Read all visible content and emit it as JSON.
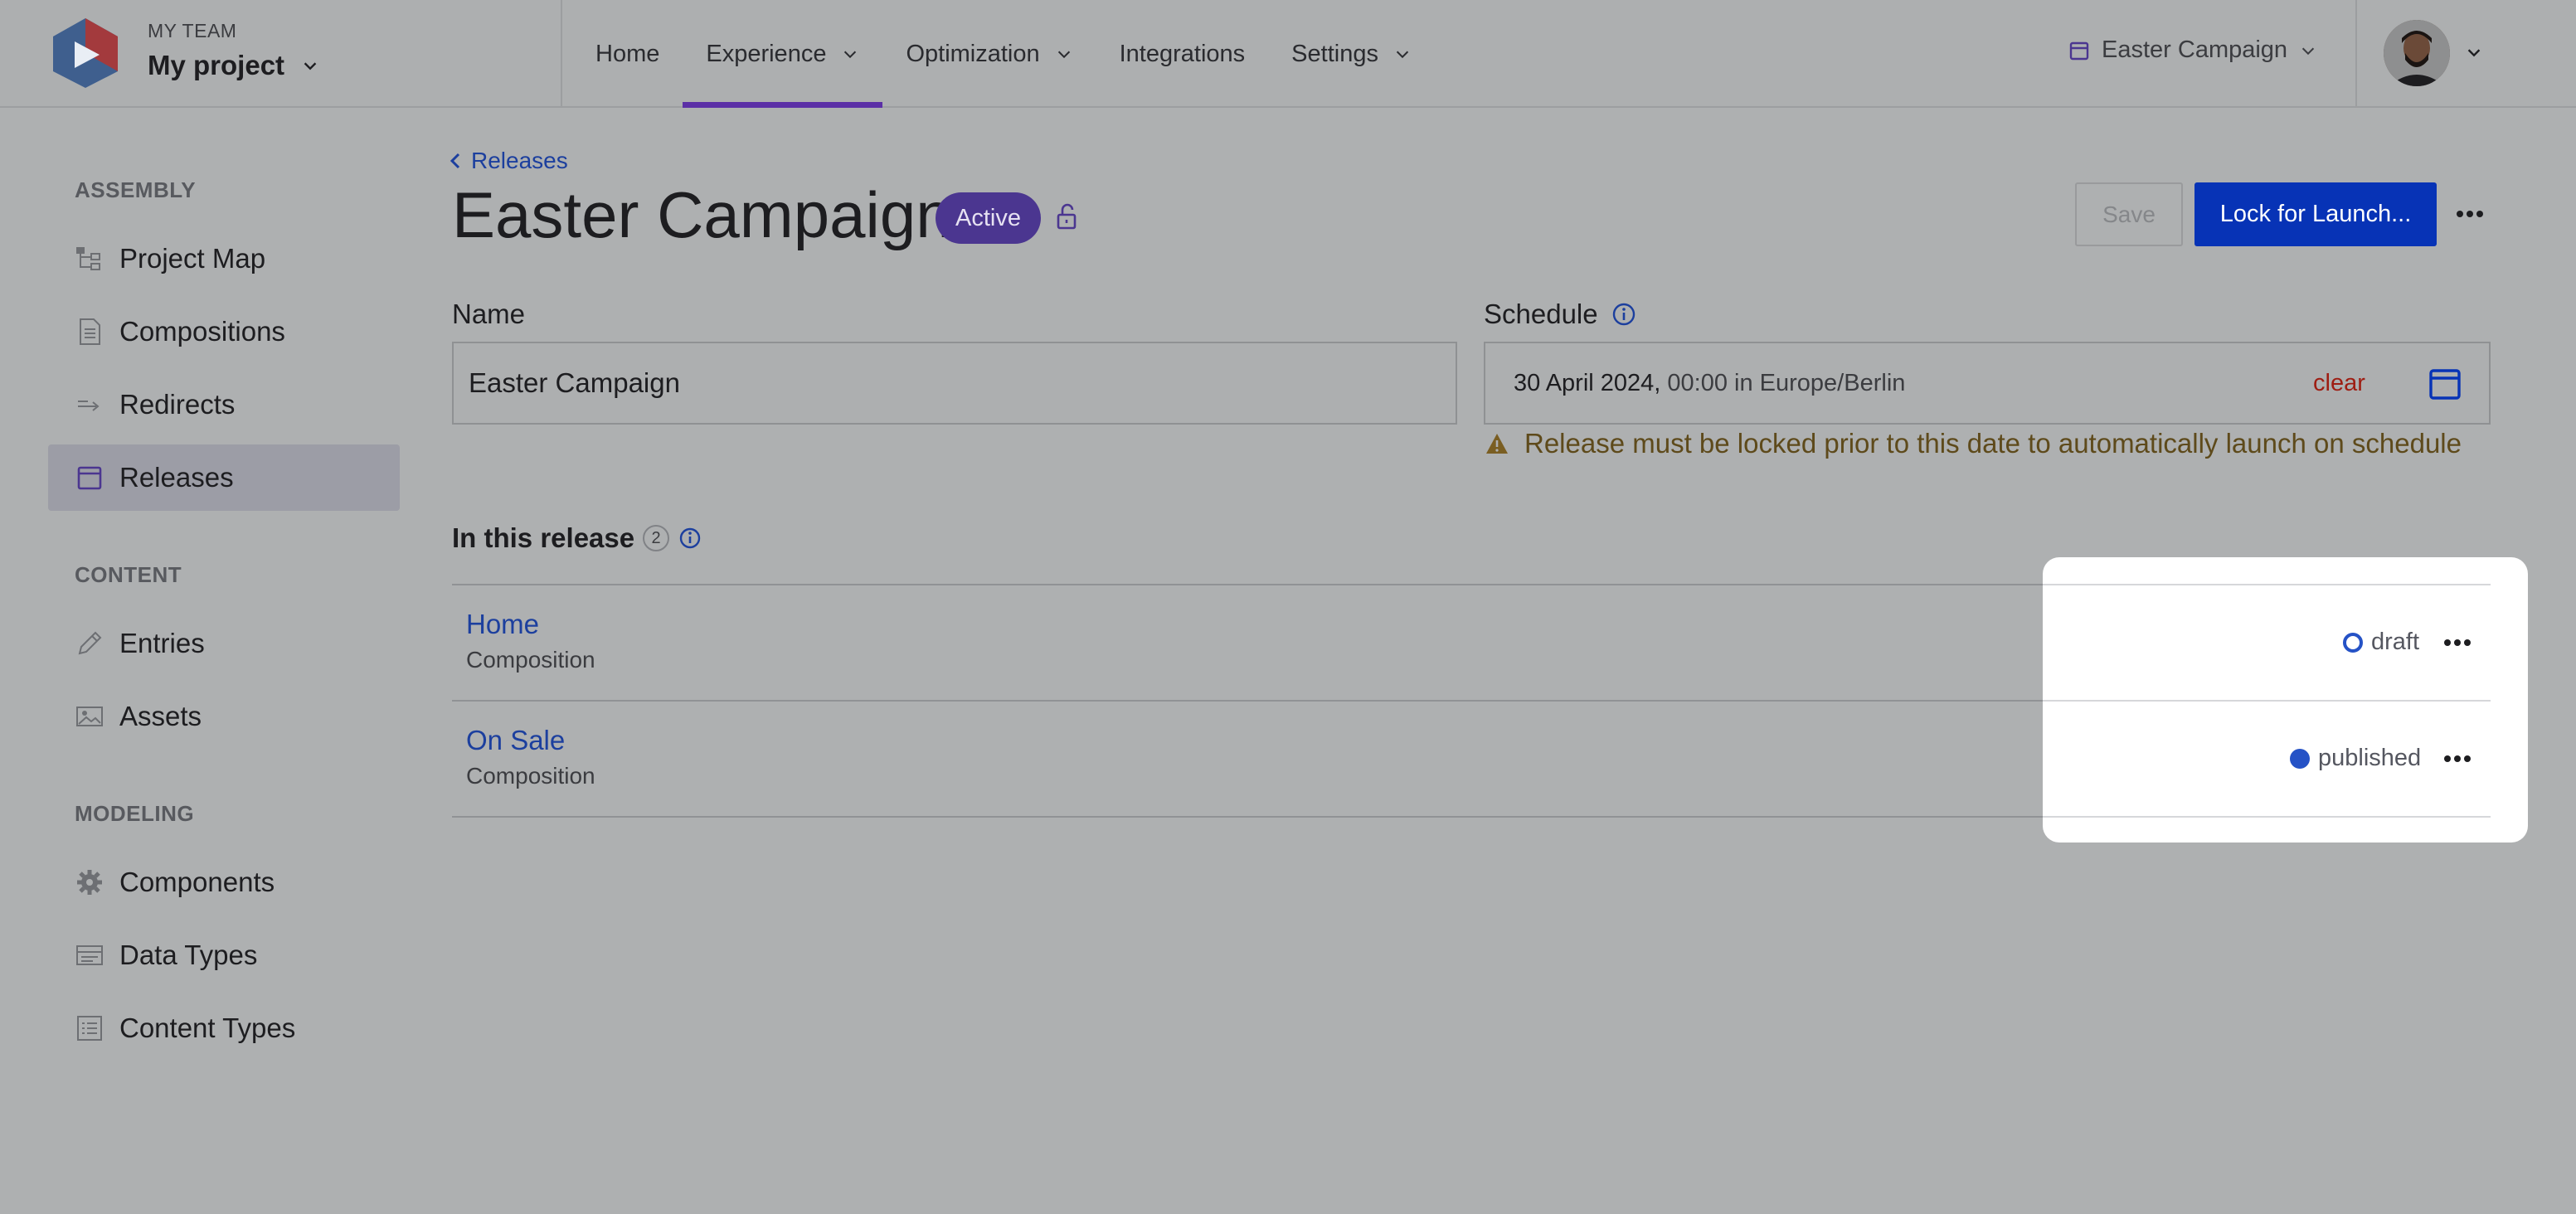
{
  "header": {
    "team_label": "MY TEAM",
    "project_name": "My project",
    "nav": [
      {
        "label": "Home"
      },
      {
        "label": "Experience"
      },
      {
        "label": "Optimization"
      },
      {
        "label": "Integrations"
      },
      {
        "label": "Settings"
      }
    ],
    "release_picker": "Easter Campaign"
  },
  "sidebar": {
    "sections": [
      {
        "heading": "ASSEMBLY",
        "items": [
          "Project Map",
          "Compositions",
          "Redirects",
          "Releases"
        ]
      },
      {
        "heading": "CONTENT",
        "items": [
          "Entries",
          "Assets"
        ]
      },
      {
        "heading": "MODELING",
        "items": [
          "Components",
          "Data Types",
          "Content Types"
        ]
      }
    ],
    "selected": "Releases"
  },
  "main": {
    "breadcrumb": "Releases",
    "title": "Easter Campaign",
    "status_badge": "Active",
    "save_label": "Save",
    "lock_label": "Lock for Launch...",
    "name_label": "Name",
    "name_value": "Easter Campaign",
    "schedule_label": "Schedule",
    "schedule_date": "30 April 2024,",
    "schedule_rest": " 00:00 in Europe/Berlin",
    "schedule_clear": "clear",
    "warning": "Release must be locked prior to this date to automatically launch on schedule",
    "section_title": "In this release",
    "item_count": "2",
    "items": [
      {
        "title": "Home",
        "type": "Composition",
        "status": "draft"
      },
      {
        "title": "On Sale",
        "type": "Composition",
        "status": "published"
      }
    ]
  },
  "colors": {
    "accent": "#0733b6",
    "link": "#1c3f9e",
    "active_badge": "#4b3690",
    "nav_underline": "#5b2fa6",
    "clear_text": "#9e1d12",
    "warning_text": "#5e4a1b"
  }
}
